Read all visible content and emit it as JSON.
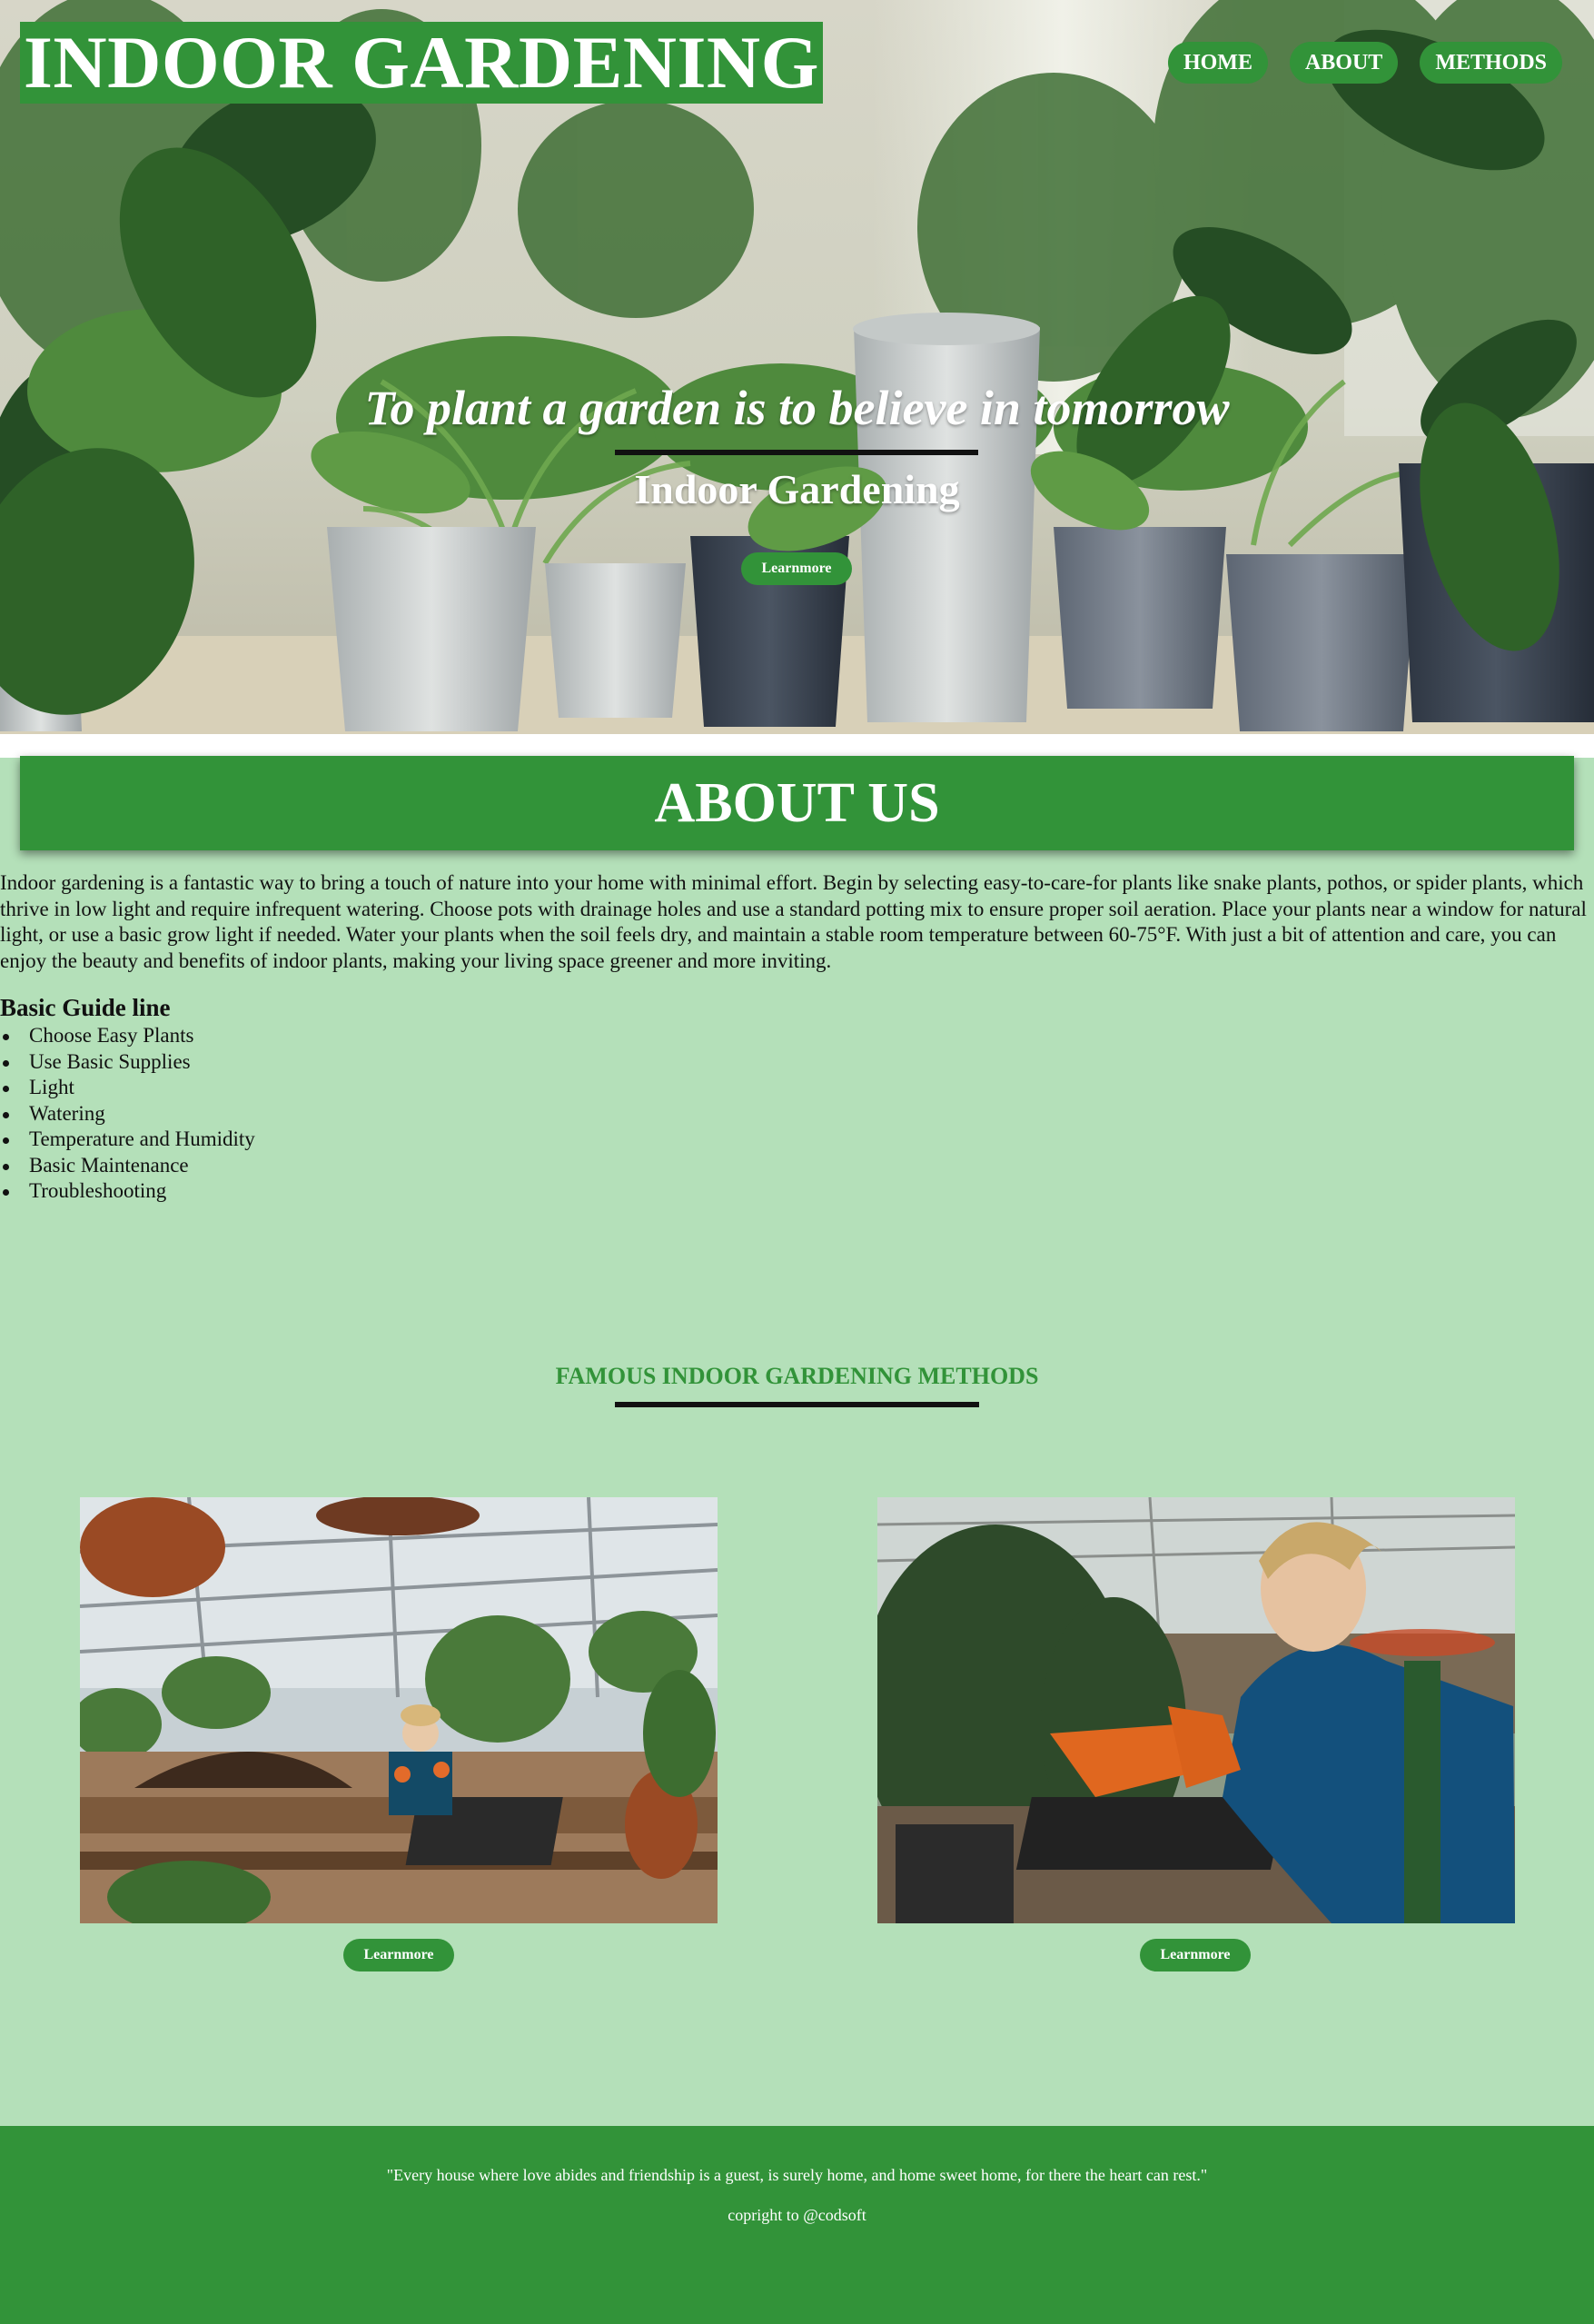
{
  "header": {
    "site_title": "INDOOR GARDENING",
    "nav": [
      "HOME",
      "ABOUT",
      "METHODS"
    ]
  },
  "hero": {
    "quote": "To plant a garden is to believe in tomorrow",
    "subtitle": "Indoor Gardening",
    "button": "Learnmore"
  },
  "about": {
    "heading": "ABOUT US",
    "paragraph": "Indoor gardening is a fantastic way to bring a touch of nature into your home with minimal effort. Begin by selecting easy-to-care-for plants like snake plants, pothos, or spider plants, which thrive in low light and require infrequent watering. Choose pots with drainage holes and use a standard potting mix to ensure proper soil aeration. Place your plants near a window for natural light, or use a basic grow light if needed. Water your plants when the soil feels dry, and maintain a stable room temperature between 60-75°F. With just a bit of attention and care, you can enjoy the beauty and benefits of indoor plants, making your living space greener and more inviting.",
    "guide_heading": "Basic Guide line",
    "guide_items": [
      "Choose Easy Plants",
      "Use Basic Supplies",
      "Light",
      "Watering",
      "Temperature and Humidity",
      "Basic Maintenance",
      "Troubleshooting"
    ]
  },
  "methods": {
    "heading": "FAMOUS INDOOR GARDENING METHODS",
    "cards": [
      {
        "button": "Learnmore"
      },
      {
        "button": "Learnmore"
      }
    ]
  },
  "footer": {
    "quote": "\"Every house where love abides and friendship is a guest, is surely home, and home sweet home, for there the heart can rest.\"",
    "copyright": "copright to @codsoft"
  },
  "colors": {
    "primary_green": "#329339",
    "page_background": "#b4e0b9"
  }
}
